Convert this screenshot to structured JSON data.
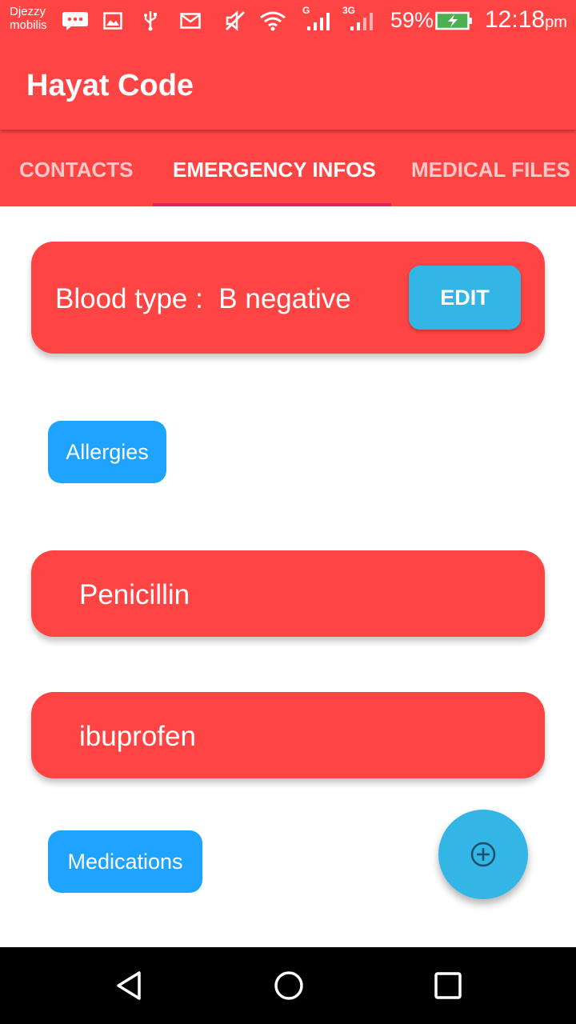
{
  "status_bar": {
    "carrier_line1": "Djezzy",
    "carrier_line2": "mobilis",
    "signal_1_label": "G",
    "signal_2_label": "3G",
    "battery_percent": "59%",
    "time": "12:18",
    "time_suffix": "pm",
    "icons": [
      "message-icon",
      "image-icon",
      "usb-icon",
      "mail-icon",
      "mute-icon",
      "wifi-icon",
      "signal-icon",
      "signal-icon",
      "battery-charging-icon"
    ]
  },
  "app_bar": {
    "title": "Hayat Code"
  },
  "tabs": [
    {
      "label": "CONTACTS"
    },
    {
      "label": "EMERGENCY INFOS",
      "selected": true
    },
    {
      "label": "MEDICAL FILES"
    }
  ],
  "blood": {
    "label": "Blood type :  B negative",
    "edit_label": "EDIT"
  },
  "sections": {
    "allergies": "Allergies",
    "medications": "Medications"
  },
  "allergies": [
    "Penicillin",
    "ibuprofen"
  ],
  "fab": {
    "icon": "add-circle-icon"
  },
  "nav": {
    "icons": [
      "back-icon",
      "home-icon",
      "recents-icon"
    ]
  },
  "colors": {
    "primary": "#ff4444",
    "accent": "#33b5e5",
    "chip": "#1ea3ff",
    "indicator": "#e0245e"
  }
}
